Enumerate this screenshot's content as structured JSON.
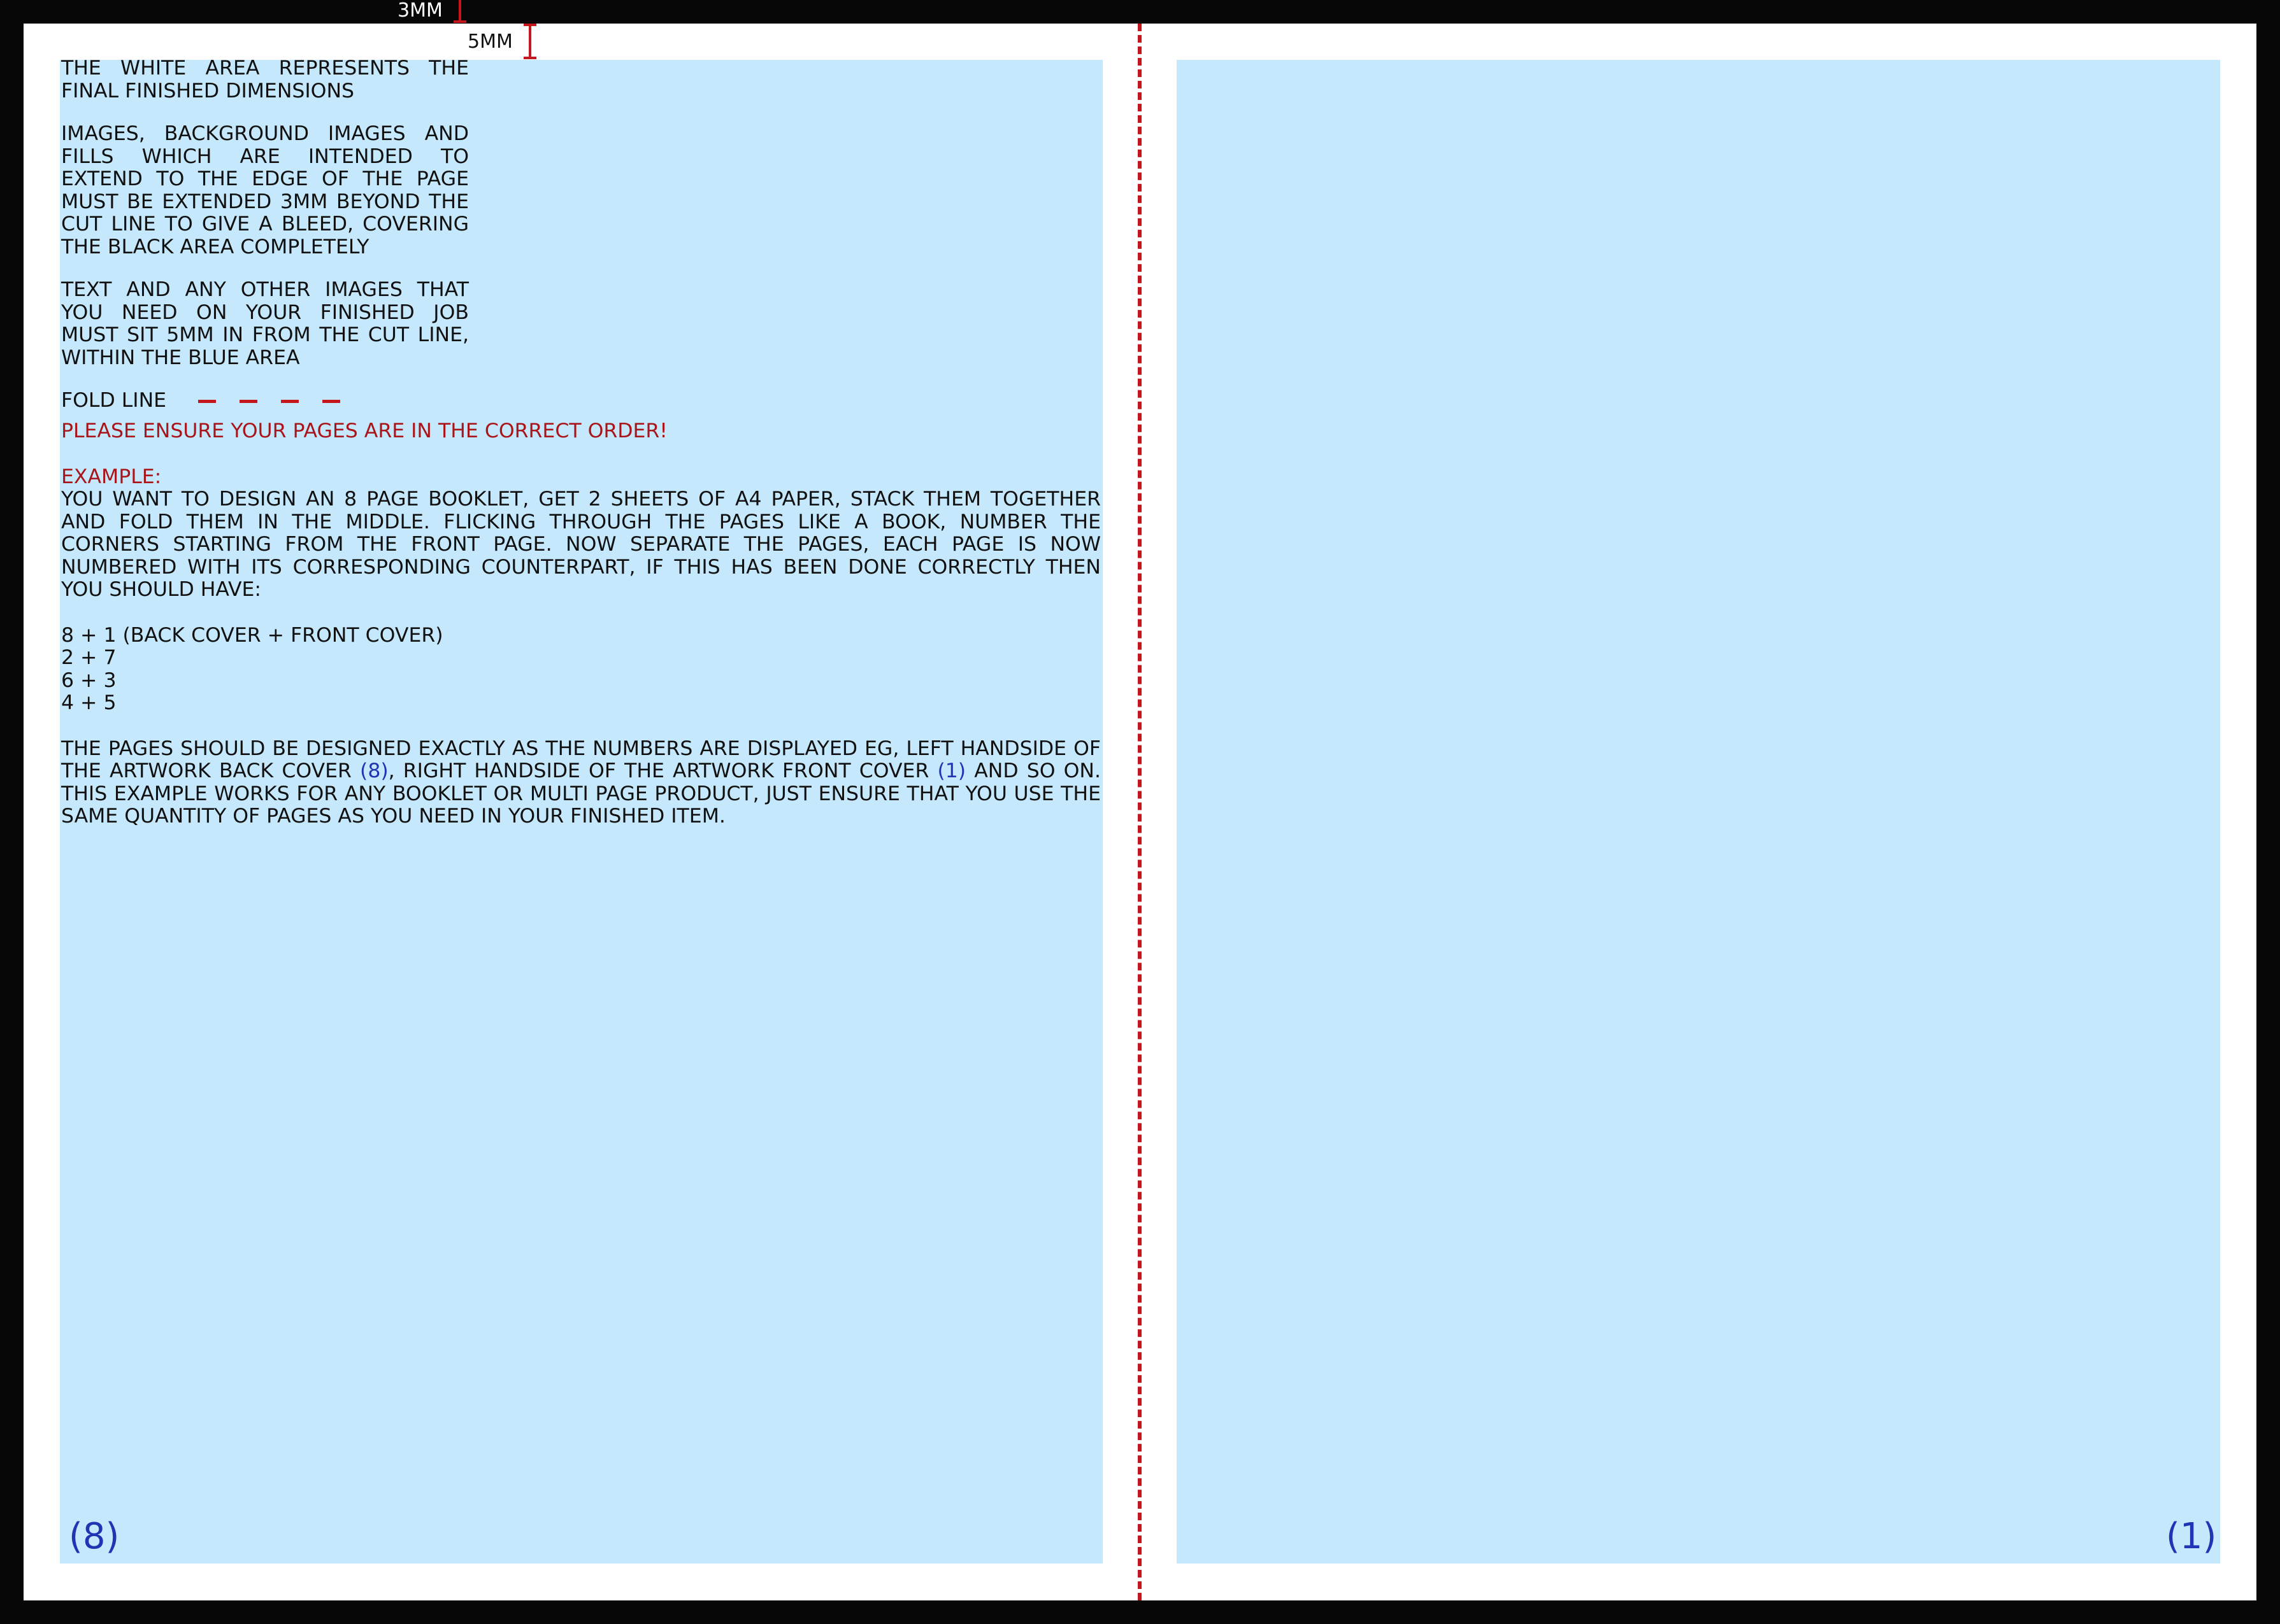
{
  "bleed_label": "3MM",
  "margin_label": "5MM",
  "notes": {
    "p1": "THE WHITE AREA REPRESENTS THE FINAL FINISHED DIMENSIONS",
    "p2": "IMAGES, BACKGROUND IMAGES AND FILLS WHICH ARE INTENDED TO EXTEND TO THE EDGE OF THE PAGE MUST BE EXTENDED 3MM BEYOND THE CUT LINE TO GIVE A BLEED, COVERING THE BLACK AREA COMPLETELY",
    "p3": "TEXT AND ANY OTHER IMAGES THAT YOU NEED ON YOUR FINISHED JOB MUST SIT 5MM IN FROM THE CUT LINE, WITHIN THE BLUE AREA",
    "fold_line_label": "FOLD LINE"
  },
  "warning": "PLEASE ENSURE YOUR PAGES ARE IN THE CORRECT ORDER!",
  "example": {
    "heading": "EXAMPLE:",
    "body": "YOU WANT TO DESIGN AN 8 PAGE BOOKLET, GET 2 SHEETS OF A4 PAPER, STACK THEM TOGETHER AND FOLD THEM IN THE MIDDLE. FLICKING THROUGH THE PAGES LIKE A BOOK, NUMBER THE CORNERS STARTING FROM THE FRONT PAGE. NOW SEPARATE THE PAGES, EACH PAGE IS NOW NUMBERED WITH ITS CORRESPONDING COUNTERPART, IF THIS HAS BEEN DONE CORRECTLY THEN YOU SHOULD HAVE:",
    "pairs": [
      "8 + 1 (BACK COVER + FRONT COVER)",
      "2 + 7",
      "6 + 3",
      "4 + 5"
    ],
    "closing_a": "THE PAGES SHOULD BE DESIGNED EXACTLY AS THE NUMBERS ARE DISPLAYED EG, LEFT HANDSIDE OF THE ARTWORK BACK COVER ",
    "closing_num8": "(8)",
    "closing_b": ", RIGHT HANDSIDE OF THE ARTWORK FRONT COVER ",
    "closing_num1": "(1)",
    "closing_c": " AND SO ON. THIS EXAMPLE WORKS FOR ANY BOOKLET OR MULTI PAGE PRODUCT, JUST ENSURE THAT YOU USE THE SAME QUANTITY OF PAGES AS YOU NEED IN YOUR FINISHED ITEM."
  },
  "page_numbers": {
    "left": "(8)",
    "right": "(1)"
  },
  "colors": {
    "bleed": "#070707",
    "trim": "#ffffff",
    "safe_area": "#c6e8fc",
    "fold_line": "#c4161c",
    "warning": "#a8151a",
    "page_number": "#1f35b4"
  }
}
